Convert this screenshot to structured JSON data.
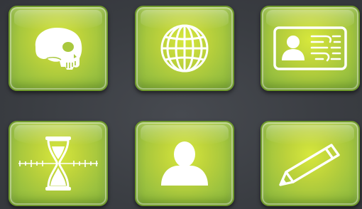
{
  "theme": {
    "background": "#3b3e44",
    "tile_color": "#bcd23b",
    "icon_color": "#ffffff"
  },
  "tiles": [
    {
      "id": "t1",
      "icon": "skull-icon"
    },
    {
      "id": "t2",
      "icon": "globe-icon"
    },
    {
      "id": "t3",
      "icon": "id-card-icon"
    },
    {
      "id": "t4",
      "icon": "hourglass-ruler-icon"
    },
    {
      "id": "t5",
      "icon": "user-icon"
    },
    {
      "id": "t6",
      "icon": "pencil-icon"
    }
  ]
}
